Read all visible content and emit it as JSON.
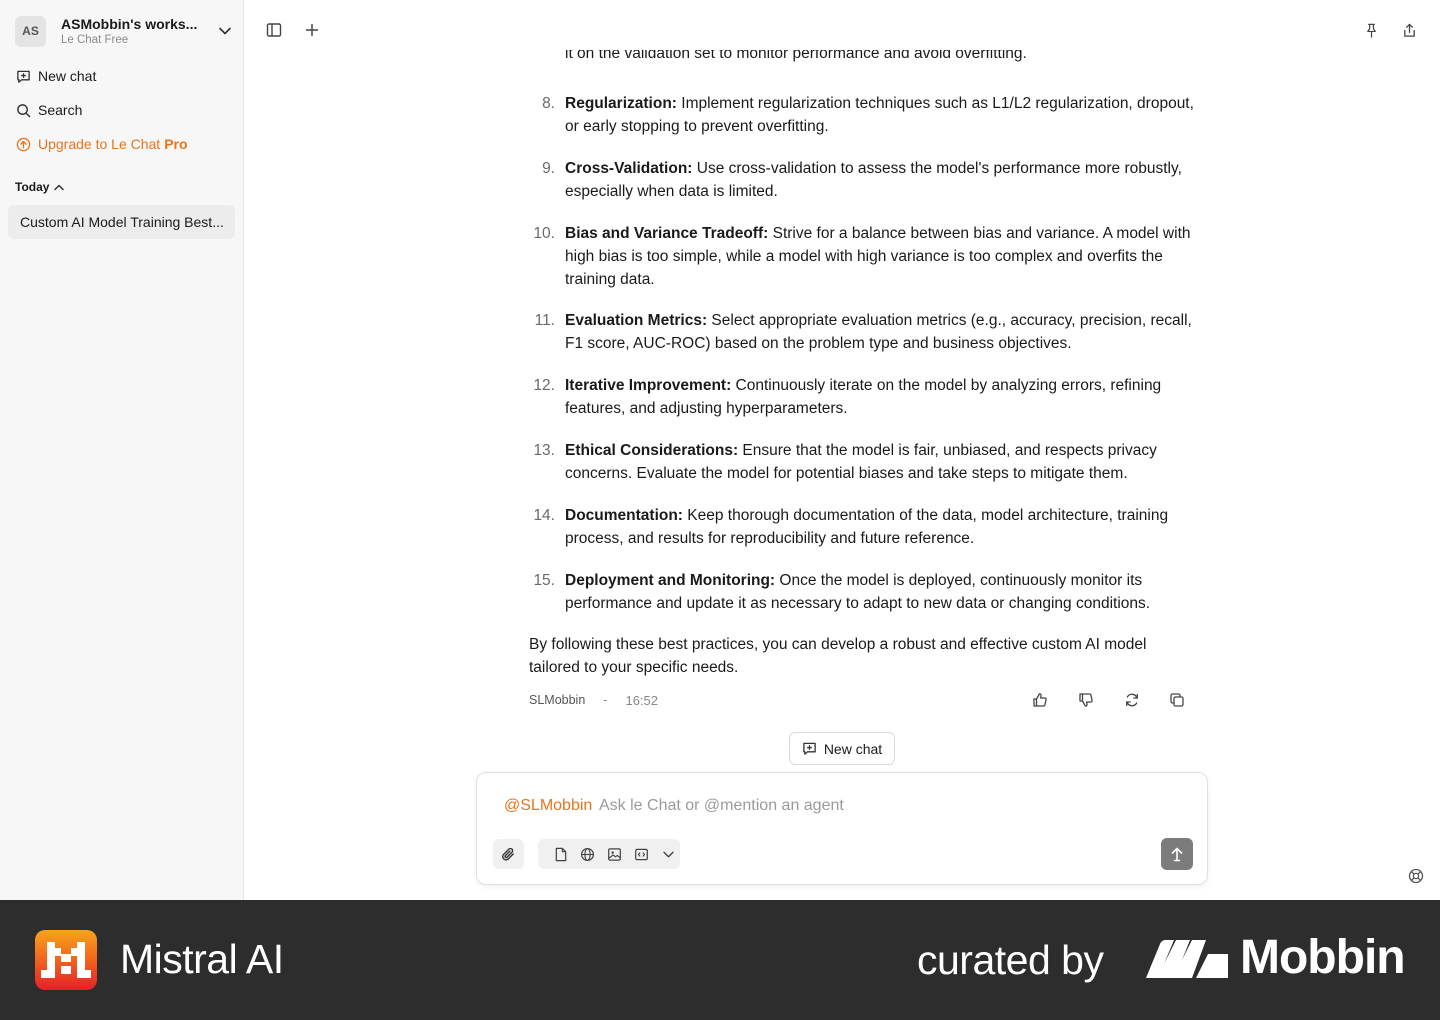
{
  "sidebar": {
    "workspace_initials": "AS",
    "workspace_name": "ASMobbin's works...",
    "workspace_plan": "Le Chat Free",
    "new_chat": "New chat",
    "search": "Search",
    "upgrade_prefix": "Upgrade to Le Chat",
    "upgrade_pro": "Pro",
    "section_today": "Today",
    "history": [
      "Custom AI Model Training Best..."
    ]
  },
  "message": {
    "clipped_line": "it on the validation set to monitor performance and avoid overfitting.",
    "items": [
      {
        "num": "8.",
        "title": "Regularization:",
        "text": " Implement regularization techniques such as L1/L2 regularization, dropout, or early stopping to prevent overfitting."
      },
      {
        "num": "9.",
        "title": "Cross-Validation:",
        "text": " Use cross-validation to assess the model's performance more robustly, especially when data is limited."
      },
      {
        "num": "10.",
        "title": "Bias and Variance Tradeoff:",
        "text": " Strive for a balance between bias and variance. A model with high bias is too simple, while a model with high variance is too complex and overfits the training data."
      },
      {
        "num": "11.",
        "title": "Evaluation Metrics:",
        "text": " Select appropriate evaluation metrics (e.g., accuracy, precision, recall, F1 score, AUC-ROC) based on the problem type and business objectives."
      },
      {
        "num": "12.",
        "title": "Iterative Improvement:",
        "text": " Continuously iterate on the model by analyzing errors, refining features, and adjusting hyperparameters."
      },
      {
        "num": "13.",
        "title": "Ethical Considerations:",
        "text": " Ensure that the model is fair, unbiased, and respects privacy concerns. Evaluate the model for potential biases and take steps to mitigate them."
      },
      {
        "num": "14.",
        "title": "Documentation:",
        "text": " Keep thorough documentation of the data, model architecture, training process, and results for reproducibility and future reference."
      },
      {
        "num": "15.",
        "title": "Deployment and Monitoring:",
        "text": " Once the model is deployed, continuously monitor its performance and update it as necessary to adapt to new data or changing conditions."
      }
    ],
    "closing": "By following these best practices, you can develop a robust and effective custom AI model tailored to your specific needs.",
    "author": "SLMobbin",
    "separator": "-",
    "time": "16:52"
  },
  "new_chat_button": "New chat",
  "composer": {
    "mention": "@SLMobbin",
    "placeholder": "Ask le Chat or @mention an agent"
  },
  "footer": {
    "brand": "Mistral AI",
    "curated": "curated by",
    "mobbin": "Mobbin"
  },
  "colors": {
    "accent": "#e8741c",
    "footer_bg": "#2d2d2d",
    "sidebar_bg": "#f7f7f7"
  }
}
